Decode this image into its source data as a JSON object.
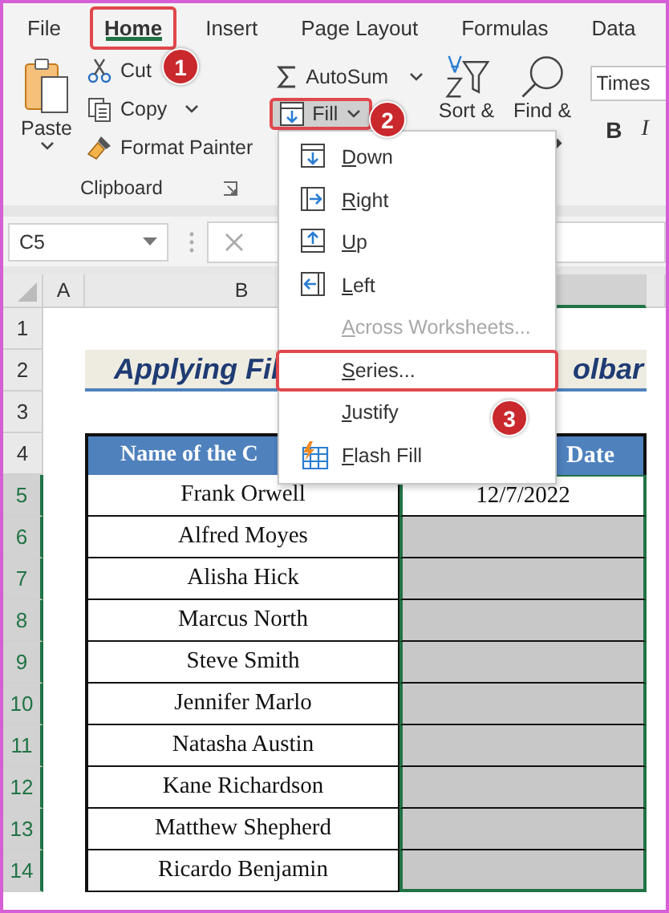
{
  "tabs": [
    {
      "label": "File",
      "selected": false
    },
    {
      "label": "Home",
      "selected": true
    },
    {
      "label": "Insert",
      "selected": false
    },
    {
      "label": "Page Layout",
      "selected": false
    },
    {
      "label": "Formulas",
      "selected": false
    },
    {
      "label": "Data",
      "selected": false
    }
  ],
  "clipboard": {
    "paste": "Paste",
    "cut": "Cut",
    "copy": "Copy",
    "format_painter": "Format Painter",
    "label": "Clipboard"
  },
  "editing": {
    "autosum": "AutoSum",
    "fill": "Fill",
    "fill_pressed": true,
    "sort": "Sort &",
    "find": "Find &"
  },
  "font": {
    "name": "Times",
    "bold": "B",
    "italic": "I"
  },
  "name_box": "C5",
  "columns": [
    {
      "label": "A",
      "selected": false
    },
    {
      "label": "B",
      "selected": false
    },
    {
      "selected": true
    }
  ],
  "title": {
    "left": "Applying Fil",
    "right": "olbar"
  },
  "table": {
    "headers": [
      "Name of the C",
      "Date"
    ],
    "rows": [
      {
        "name": "Frank Orwell",
        "date": "12/7/2022",
        "highlighted": false
      },
      {
        "name": "Alfred Moyes",
        "highlighted": true
      },
      {
        "name": "Alisha Hick",
        "highlighted": true
      },
      {
        "name": "Marcus North",
        "highlighted": true
      },
      {
        "name": "Steve Smith",
        "highlighted": true
      },
      {
        "name": "Jennifer Marlo",
        "highlighted": true
      },
      {
        "name": "Natasha Austin",
        "highlighted": true
      },
      {
        "name": "Kane Richardson",
        "highlighted": true
      },
      {
        "name": "Matthew Shepherd",
        "highlighted": true
      },
      {
        "name": "Ricardo Benjamin",
        "highlighted": true
      }
    ]
  },
  "row_headers": [
    {
      "label": "1",
      "selected": false
    },
    {
      "label": "2",
      "selected": false
    },
    {
      "label": "3",
      "selected": false
    },
    {
      "label": "4",
      "selected": false
    },
    {
      "label": "5",
      "selected": true
    },
    {
      "label": "6",
      "selected": true
    },
    {
      "label": "7",
      "selected": true
    },
    {
      "label": "8",
      "selected": true
    },
    {
      "label": "9",
      "selected": true
    },
    {
      "label": "10",
      "selected": true
    },
    {
      "label": "11",
      "selected": true
    },
    {
      "label": "12",
      "selected": true
    },
    {
      "label": "13",
      "selected": true
    },
    {
      "label": "14",
      "selected": true
    }
  ],
  "fill_menu": {
    "items": [
      {
        "label": "Down",
        "kind": "down",
        "disabled": false,
        "selected": false
      },
      {
        "label": "Right",
        "kind": "right",
        "disabled": false,
        "selected": false
      },
      {
        "label": "Up",
        "kind": "up",
        "disabled": false,
        "selected": false
      },
      {
        "label": "Left",
        "kind": "left",
        "disabled": false,
        "selected": false
      },
      {
        "label": "Across Worksheets...",
        "kind": "plain",
        "disabled": true,
        "selected": false
      },
      {
        "label": "Series...",
        "kind": "plain",
        "disabled": false,
        "selected": true
      },
      {
        "label": "Justify",
        "kind": "plain",
        "disabled": false,
        "selected": false
      },
      {
        "label": "Flash Fill",
        "kind": "flash",
        "disabled": false,
        "selected": false
      }
    ]
  },
  "callouts": [
    "1",
    "2",
    "3"
  ]
}
